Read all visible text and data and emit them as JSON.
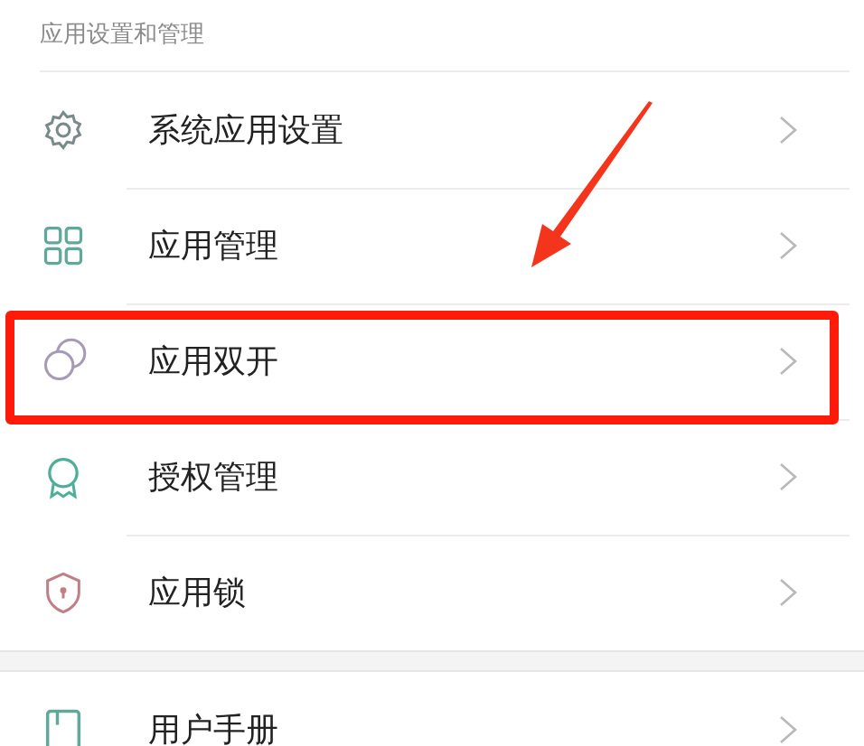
{
  "section_header": "应用设置和管理",
  "sections": [
    {
      "items": [
        {
          "label": "系统应用设置",
          "kind": "gear",
          "highlighted": false
        },
        {
          "label": "应用管理",
          "kind": "grid",
          "highlighted": false
        },
        {
          "label": "应用双开",
          "kind": "circles",
          "highlighted": true
        },
        {
          "label": "授权管理",
          "kind": "ribbon",
          "highlighted": false
        },
        {
          "label": "应用锁",
          "kind": "shield",
          "highlighted": false
        }
      ]
    },
    {
      "items": [
        {
          "label": "用户手册",
          "kind": "book",
          "highlighted": false
        }
      ]
    }
  ],
  "annotation_arrow": true
}
